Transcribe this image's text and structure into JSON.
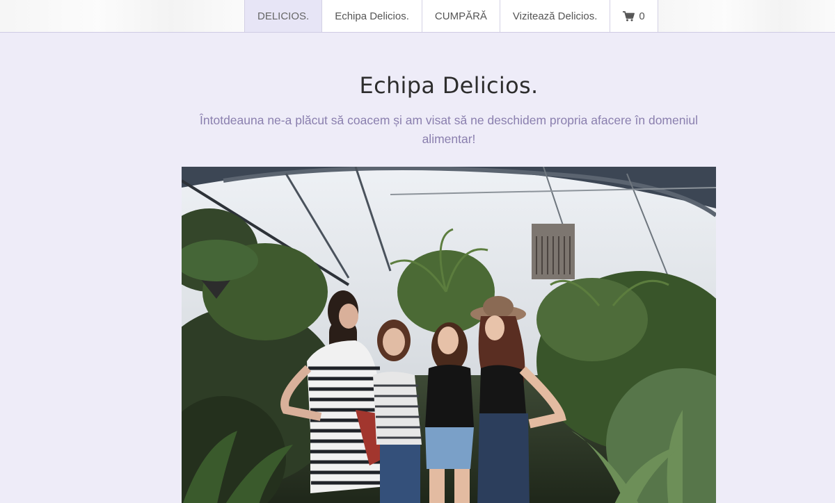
{
  "nav": {
    "items": [
      {
        "label": "DELICIOS.",
        "active": true
      },
      {
        "label": "Echipa Delicios.",
        "active": false
      },
      {
        "label": "CUMPĂRĂ",
        "active": false
      },
      {
        "label": "Vizitează Delicios.",
        "active": false
      }
    ],
    "cart": {
      "icon": "shopping-cart-icon",
      "count": "0"
    }
  },
  "main": {
    "title": "Echipa Delicios.",
    "subtitle": "Întotdeauna ne-a plăcut să coacem și am visat să ne deschidem propria afacere în domeniul alimentar!",
    "photo": {
      "subject": "team-photo"
    }
  },
  "colors": {
    "background": "#eeecf8",
    "nav_active": "#e7e5f6",
    "subtitle": "#8a7fae"
  }
}
